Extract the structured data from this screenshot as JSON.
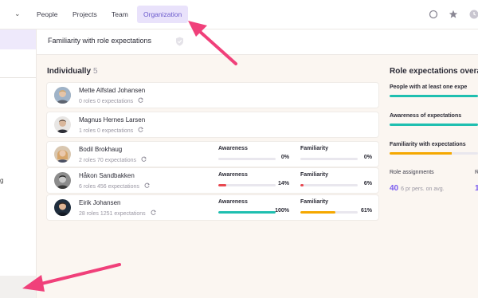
{
  "nav": {
    "items": [
      {
        "label": "People"
      },
      {
        "label": "Projects"
      },
      {
        "label": "Team"
      },
      {
        "label": "Organization",
        "active": true
      }
    ]
  },
  "sidebar": {
    "partial_text": "g"
  },
  "header": {
    "title": "Familiarity with role expectations"
  },
  "individually": {
    "title": "Individually",
    "count": "5",
    "labels": {
      "awareness": "Awareness",
      "familiarity": "Familiarity"
    },
    "people": [
      {
        "name": "Mette Alfstad Johansen",
        "roles": "0 roles",
        "expectations": "0 expectations"
      },
      {
        "name": "Magnus Hernes Larsen",
        "roles": "1 roles",
        "expectations": "0 expectations"
      },
      {
        "name": "Bodil Brokhaug",
        "roles": "2 roles",
        "expectations": "70 expectations",
        "awareness": 0,
        "awareness_text": "0%",
        "familiarity": 0,
        "familiarity_text": "0%"
      },
      {
        "name": "Håkon Sandbakken",
        "roles": "6 roles",
        "expectations": "456 expectations",
        "awareness": 14,
        "awareness_text": "14%",
        "familiarity": 6,
        "familiarity_text": "6%"
      },
      {
        "name": "Eirik Johansen",
        "roles": "28 roles",
        "expectations": "1251 expectations",
        "awareness": 100,
        "awareness_text": "100%",
        "familiarity": 61,
        "familiarity_text": "61%"
      }
    ]
  },
  "overview": {
    "title": "Role expectations overa",
    "people_with_expectation": "People with at least one expe",
    "awareness_label": "Awareness of expectations",
    "familiarity_label": "Familiarity with expectations",
    "assignments_label": "Role assignments",
    "assignments_value": "40",
    "assignments_sub": "6 pr pers. on avg.",
    "second_label": "R",
    "second_value": "1"
  },
  "colors": {
    "accent": "#7b5cf0",
    "awareness_high": "#1fbfb0",
    "awareness_low": "#e8474f",
    "familiarity": "#f5a800",
    "arrow": "#f0407a"
  },
  "icons": {
    "top_right": [
      "search-icon",
      "star-icon",
      "clock-icon"
    ],
    "refresh": "refresh-icon",
    "shield": "shield-icon"
  }
}
